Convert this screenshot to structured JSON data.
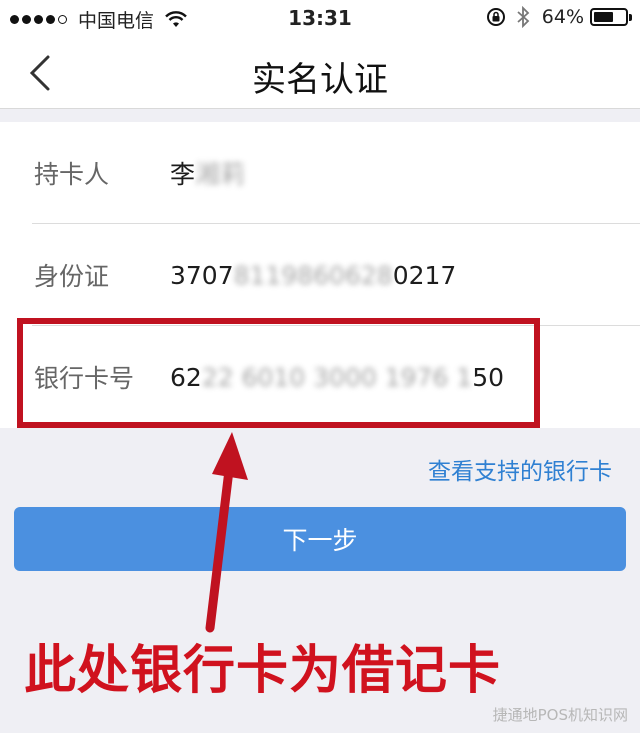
{
  "status_bar": {
    "carrier": "中国电信",
    "time": "13:31",
    "battery_percent": "64%",
    "battery_level": 0.64,
    "icons": [
      "signal-dots-icon",
      "wifi-icon",
      "rotation-lock-icon",
      "bluetooth-icon",
      "battery-icon"
    ]
  },
  "nav": {
    "title": "实名认证",
    "back_icon": "chevron-left-icon"
  },
  "form": {
    "rows": [
      {
        "label": "持卡人",
        "value_visible": "李",
        "value_masked": "湘莉"
      },
      {
        "label": "身份证",
        "value_start": "3707",
        "value_masked": "8119860628",
        "value_end": "0217"
      },
      {
        "label": "银行卡号",
        "value_start": "62",
        "value_masked": "22 6010 3000 1976 1",
        "value_end": "50"
      }
    ]
  },
  "support_link": "查看支持的银行卡",
  "next_button": "下一步",
  "annotation": {
    "text": "此处银行卡为借记卡",
    "color": "#d0121e"
  },
  "watermark": "捷通地POS机知识网",
  "colors": {
    "accent_blue": "#4b90e0",
    "link_blue": "#2f80d2",
    "highlight_red": "#c01220"
  }
}
